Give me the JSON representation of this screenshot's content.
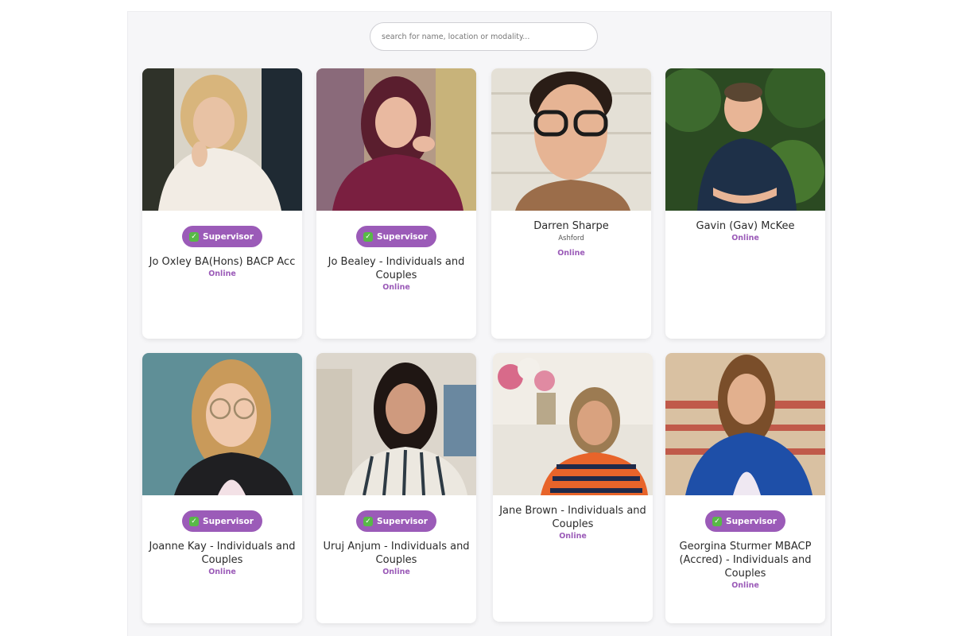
{
  "search": {
    "placeholder": "search for name, location or modality..."
  },
  "badge_label": "Supervisor",
  "badge_icon": "checkmark-icon",
  "colors": {
    "accent": "#9b5bb8",
    "check": "#58b947"
  },
  "therapists": [
    {
      "name": "Jo Oxley BA(Hons) BACP Acc",
      "status": "Online",
      "supervisor": true
    },
    {
      "name": "Jo Bealey - Individuals and Couples",
      "status": "Online",
      "supervisor": true
    },
    {
      "name": "Darren Sharpe",
      "location": "Ashford",
      "status": "Online",
      "supervisor": false
    },
    {
      "name": "Gavin (Gav) McKee",
      "status": "Online",
      "supervisor": false
    },
    {
      "name": "Joanne Kay - Individuals and Couples",
      "status": "Online",
      "supervisor": true
    },
    {
      "name": "Uruj Anjum - Individuals and Couples",
      "status": "Online",
      "supervisor": true
    },
    {
      "name": "Jane Brown - Individuals and Couples",
      "status": "Online",
      "supervisor": false
    },
    {
      "name": "Georgina Sturmer MBACP (Accred) - Individuals and Couples",
      "status": "Online",
      "supervisor": true
    }
  ]
}
